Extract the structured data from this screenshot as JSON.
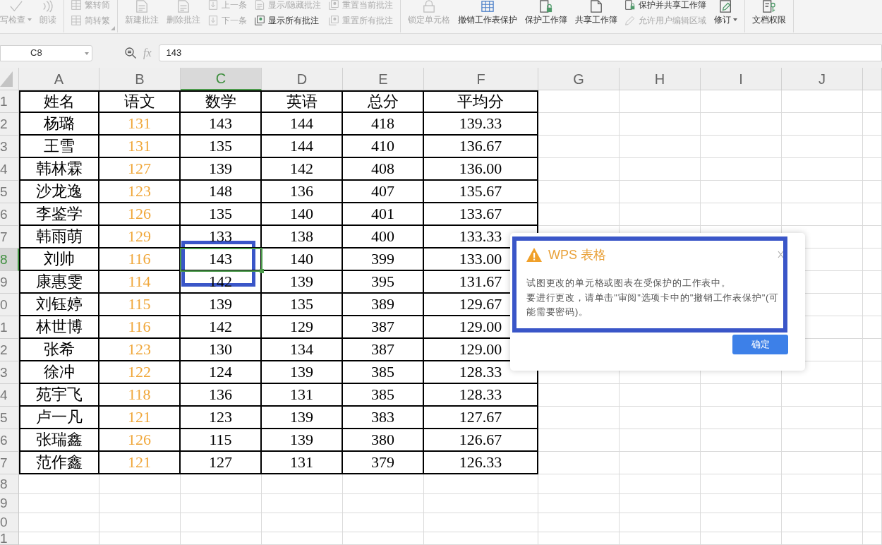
{
  "ribbon": {
    "groups": [
      {
        "items": [
          {
            "kind": "large",
            "label": "写检查",
            "disabled": true,
            "dropdown": true
          },
          {
            "kind": "large",
            "label": "朗读",
            "disabled": true,
            "dropdown": false
          }
        ]
      },
      {
        "launcher": true,
        "items": [
          {
            "kind": "stack",
            "buttons": [
              {
                "label": "繁转简",
                "disabled": true
              },
              {
                "label": "简转繁",
                "disabled": true
              }
            ]
          }
        ]
      },
      {
        "items": [
          {
            "kind": "large",
            "label": "新建批注",
            "disabled": true,
            "dropdown": false
          },
          {
            "kind": "large",
            "label": "删除批注",
            "disabled": true,
            "dropdown": false
          },
          {
            "kind": "stack",
            "buttons": [
              {
                "label": "上一条",
                "disabled": true
              },
              {
                "label": "下一条",
                "disabled": true
              }
            ]
          },
          {
            "kind": "stack",
            "buttons": [
              {
                "label": "显示/隐藏批注",
                "disabled": true
              },
              {
                "label": "显示所有批注",
                "disabled": false
              }
            ]
          },
          {
            "kind": "stack",
            "buttons": [
              {
                "label": "重置当前批注",
                "disabled": true
              },
              {
                "label": "重置所有批注",
                "disabled": true
              }
            ]
          }
        ]
      },
      {
        "items": [
          {
            "kind": "large",
            "label": "锁定单元格",
            "disabled": true,
            "dropdown": false
          },
          {
            "kind": "large",
            "label": "撤销工作表保护",
            "disabled": false,
            "dropdown": false
          },
          {
            "kind": "large",
            "label": "保护工作簿",
            "disabled": false,
            "dropdown": false
          },
          {
            "kind": "large",
            "label": "共享工作簿",
            "disabled": false,
            "dropdown": false
          },
          {
            "kind": "stack",
            "buttons": [
              {
                "label": "保护并共享工作簿",
                "disabled": false
              },
              {
                "label": "允许用户编辑区域",
                "disabled": true
              }
            ]
          },
          {
            "kind": "large",
            "label": "修订",
            "disabled": false,
            "dropdown": true
          }
        ]
      },
      {
        "items": [
          {
            "kind": "large",
            "label": "文档权限",
            "disabled": false,
            "dropdown": false
          }
        ]
      }
    ]
  },
  "formula_bar": {
    "name_box": "C8",
    "function_label": "fx",
    "value": "143"
  },
  "sheet": {
    "columns": [
      {
        "label": "A",
        "selected": false
      },
      {
        "label": "B",
        "selected": false
      },
      {
        "label": "C",
        "selected": true
      },
      {
        "label": "D",
        "selected": false
      },
      {
        "label": "E",
        "selected": false
      },
      {
        "label": "F",
        "selected": false
      },
      {
        "label": "G",
        "selected": false
      },
      {
        "label": "H",
        "selected": false
      },
      {
        "label": "I",
        "selected": false
      },
      {
        "label": "J",
        "selected": false
      }
    ],
    "rows": [
      {
        "label": "1",
        "selected": false,
        "cells": [
          {
            "text": "姓名"
          },
          {
            "text": "语文"
          },
          {
            "text": "数学"
          },
          {
            "text": "英语"
          },
          {
            "text": "总分"
          },
          {
            "text": "平均分"
          }
        ]
      },
      {
        "label": "2",
        "selected": false,
        "cells": [
          {
            "text": "杨璐"
          },
          {
            "text": "131",
            "color": "#f0a73a"
          },
          {
            "text": "143"
          },
          {
            "text": "144"
          },
          {
            "text": "418"
          },
          {
            "text": "139.33"
          }
        ]
      },
      {
        "label": "3",
        "selected": false,
        "cells": [
          {
            "text": "王雪"
          },
          {
            "text": "131",
            "color": "#f0a73a"
          },
          {
            "text": "135"
          },
          {
            "text": "144"
          },
          {
            "text": "410"
          },
          {
            "text": "136.67"
          }
        ]
      },
      {
        "label": "4",
        "selected": false,
        "cells": [
          {
            "text": "韩林霖"
          },
          {
            "text": "127",
            "color": "#f0a73a"
          },
          {
            "text": "139"
          },
          {
            "text": "142"
          },
          {
            "text": "408"
          },
          {
            "text": "136.00"
          }
        ]
      },
      {
        "label": "5",
        "selected": false,
        "cells": [
          {
            "text": "沙龙逸"
          },
          {
            "text": "123",
            "color": "#f0a73a"
          },
          {
            "text": "148"
          },
          {
            "text": "136"
          },
          {
            "text": "407"
          },
          {
            "text": "135.67"
          }
        ]
      },
      {
        "label": "6",
        "selected": false,
        "cells": [
          {
            "text": "李鉴学"
          },
          {
            "text": "126",
            "color": "#f0a73a"
          },
          {
            "text": "135"
          },
          {
            "text": "140"
          },
          {
            "text": "401"
          },
          {
            "text": "133.67"
          }
        ]
      },
      {
        "label": "7",
        "selected": false,
        "cells": [
          {
            "text": "韩雨萌"
          },
          {
            "text": "129",
            "color": "#f0a73a"
          },
          {
            "text": "133"
          },
          {
            "text": "138"
          },
          {
            "text": "400"
          },
          {
            "text": "133.33"
          }
        ]
      },
      {
        "label": "8",
        "selected": true,
        "cells": [
          {
            "text": "刘帅"
          },
          {
            "text": "116",
            "color": "#f0a73a"
          },
          {
            "text": "143"
          },
          {
            "text": "140"
          },
          {
            "text": "399"
          },
          {
            "text": "133.00"
          }
        ]
      },
      {
        "label": "9",
        "selected": false,
        "cells": [
          {
            "text": "康惠雯"
          },
          {
            "text": "114",
            "color": "#f0a73a"
          },
          {
            "text": "142"
          },
          {
            "text": "139"
          },
          {
            "text": "395"
          },
          {
            "text": "131.67"
          }
        ]
      },
      {
        "label": "0",
        "selected": false,
        "cells": [
          {
            "text": "刘钰婷"
          },
          {
            "text": "115",
            "color": "#f0a73a"
          },
          {
            "text": "139"
          },
          {
            "text": "135"
          },
          {
            "text": "389"
          },
          {
            "text": "129.67"
          }
        ]
      },
      {
        "label": "1",
        "selected": false,
        "cells": [
          {
            "text": "林世博"
          },
          {
            "text": "116",
            "color": "#f0a73a"
          },
          {
            "text": "142"
          },
          {
            "text": "129"
          },
          {
            "text": "387"
          },
          {
            "text": "129.00"
          }
        ]
      },
      {
        "label": "2",
        "selected": false,
        "cells": [
          {
            "text": "张希"
          },
          {
            "text": "123",
            "color": "#f0a73a"
          },
          {
            "text": "130"
          },
          {
            "text": "134"
          },
          {
            "text": "387"
          },
          {
            "text": "129.00"
          }
        ]
      },
      {
        "label": "3",
        "selected": false,
        "cells": [
          {
            "text": "徐冲"
          },
          {
            "text": "122",
            "color": "#f0a73a"
          },
          {
            "text": "124"
          },
          {
            "text": "139"
          },
          {
            "text": "385"
          },
          {
            "text": "128.33"
          }
        ]
      },
      {
        "label": "4",
        "selected": false,
        "cells": [
          {
            "text": "苑宇飞"
          },
          {
            "text": "118",
            "color": "#f0a73a"
          },
          {
            "text": "136"
          },
          {
            "text": "131"
          },
          {
            "text": "385"
          },
          {
            "text": "128.33"
          }
        ]
      },
      {
        "label": "5",
        "selected": false,
        "cells": [
          {
            "text": "卢一凡"
          },
          {
            "text": "121",
            "color": "#f0a73a"
          },
          {
            "text": "123"
          },
          {
            "text": "139"
          },
          {
            "text": "383"
          },
          {
            "text": "127.67"
          }
        ]
      },
      {
        "label": "6",
        "selected": false,
        "cells": [
          {
            "text": "张瑞鑫"
          },
          {
            "text": "126",
            "color": "#f0a73a"
          },
          {
            "text": "115"
          },
          {
            "text": "139"
          },
          {
            "text": "380"
          },
          {
            "text": "126.67"
          }
        ]
      },
      {
        "label": "7",
        "selected": false,
        "cells": [
          {
            "text": "范作鑫"
          },
          {
            "text": "121",
            "color": "#f0a73a"
          },
          {
            "text": "127"
          },
          {
            "text": "131"
          },
          {
            "text": "379"
          },
          {
            "text": "126.33"
          }
        ]
      },
      {
        "label": "8",
        "selected": false
      },
      {
        "label": "9",
        "selected": false
      },
      {
        "label": "0",
        "selected": false
      },
      {
        "label": "1",
        "selected": false
      }
    ]
  },
  "dialog": {
    "title": "WPS 表格",
    "message": [
      "试图更改的单元格或图表在受保护的工作表中。",
      "要进行更改，请单击\"审阅\"选项卡中的\"撤销工作表保护\"(可能需要密码)。"
    ],
    "buttons": [
      "确定"
    ]
  }
}
